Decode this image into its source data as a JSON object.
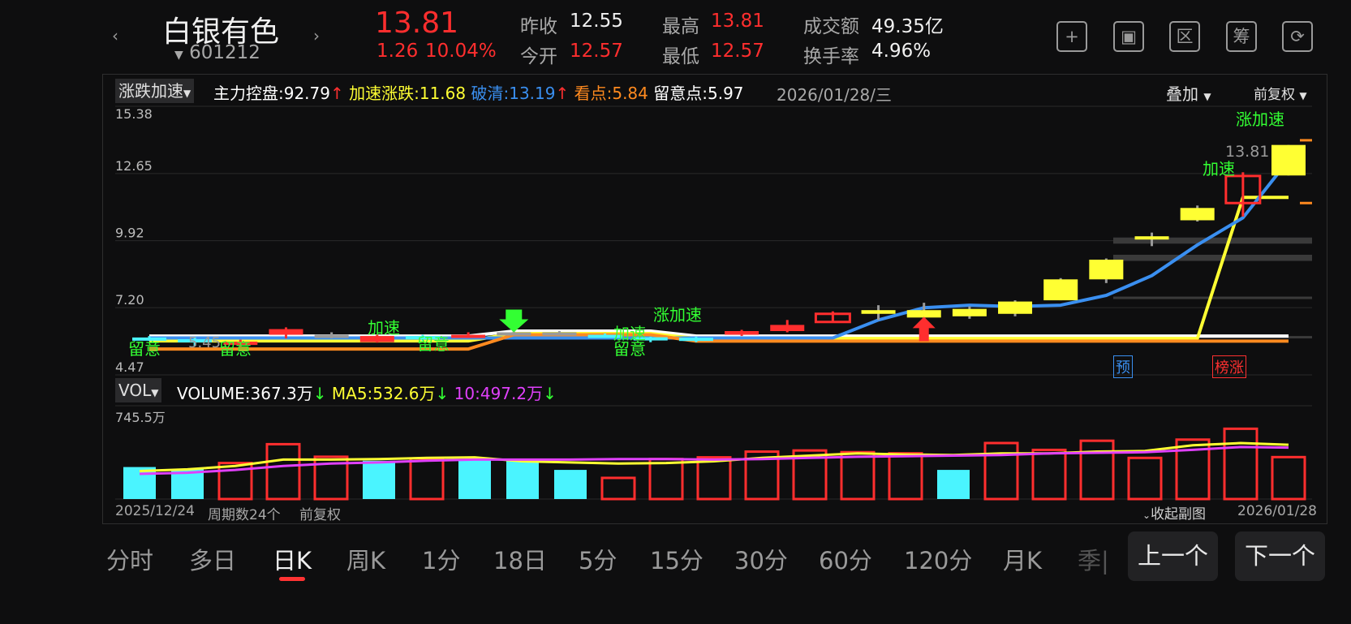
{
  "header": {
    "stock_name": "白银有色",
    "stock_code": "601212",
    "price": "13.81",
    "change": "1.26",
    "change_pct": "10.04%",
    "stats": {
      "prev_close_label": "昨收",
      "prev_close": "12.55",
      "open_label": "今开",
      "open": "12.57",
      "high_label": "最高",
      "high": "13.81",
      "low_label": "最低",
      "low": "12.57",
      "amount_label": "成交额",
      "amount": "49.35亿",
      "turnover_label": "换手率",
      "turnover": "4.96%"
    },
    "icons": [
      "add-icon",
      "screen-icon",
      "range-icon",
      "chips-icon",
      "rotate-icon"
    ],
    "icon_glyphs": {
      "add": "+",
      "screen": "▣",
      "range": "区",
      "chips": "筹",
      "rotate": "⟳"
    }
  },
  "main_chart": {
    "indicator_name": "涨跌加速",
    "indicators": [
      {
        "label": "主力控盘:92.79",
        "color": "#ffffff",
        "arrow": "↑"
      },
      {
        "label": "加速涨跌:11.68",
        "color": "#ffff33",
        "arrow": ""
      },
      {
        "label": "破清:13.19",
        "color": "#3a8ff0",
        "arrow": "↑"
      },
      {
        "label": "看点:5.84",
        "color": "#ff8a1f",
        "arrow": ""
      },
      {
        "label": "留意点:5.97",
        "color": "#ffffff",
        "arrow": ""
      }
    ],
    "date": "2026/01/28/三",
    "overlay_label": "叠加",
    "adjust_label": "前复权",
    "y_ticks": [
      "15.38",
      "12.65",
      "9.92",
      "7.20",
      "4.47"
    ],
    "price_label": "13.81",
    "annotations": {
      "zhangjiasu_top": "涨加速",
      "jiasu_right": "加速",
      "zhangjiasu_mid": "涨加速",
      "jiasu_1": "加速",
      "jiasu_2": "加速",
      "liuyi_1": "留意",
      "liuyi_2": "留意",
      "liuyi_3": "留意",
      "liuyi_4": "留意",
      "value_545": "5.45",
      "yu_badge": "预",
      "bangzhang_badge": "榜涨"
    }
  },
  "volume_chart": {
    "indicator_name": "VOL",
    "volume_label": "VOLUME:367.3万",
    "ma5_label": "MA5:532.6万",
    "ma10_label": "10:497.2万",
    "max_label": "745.5万",
    "start_date": "2025/12/24",
    "period_count": "周期数24个",
    "adjust": "前复权",
    "collapse_label": "收起副图",
    "end_date": "2026/01/28"
  },
  "chart_data": {
    "type": "candlestick",
    "ylim": [
      4.47,
      15.38
    ],
    "candles": [
      {
        "o": 5.99,
        "c": 5.97,
        "h": 6.05,
        "l": 5.85,
        "color": "cyan"
      },
      {
        "o": 5.92,
        "c": 5.88,
        "h": 6.0,
        "l": 5.65,
        "color": "cyan"
      },
      {
        "o": 5.7,
        "c": 5.82,
        "h": 5.9,
        "l": 5.6,
        "color": "red"
      },
      {
        "o": 6.1,
        "c": 6.33,
        "h": 6.4,
        "l": 5.95,
        "color": "red"
      },
      {
        "o": 6.02,
        "c": 6.1,
        "h": 6.2,
        "l": 5.95,
        "color": "gray"
      },
      {
        "o": 5.8,
        "c": 6.05,
        "h": 6.1,
        "l": 5.78,
        "color": "red"
      },
      {
        "o": 6.05,
        "c": 5.92,
        "h": 6.1,
        "l": 5.85,
        "color": "cyan"
      },
      {
        "o": 6.05,
        "c": 6.1,
        "h": 6.2,
        "l": 5.98,
        "color": "red"
      },
      {
        "o": 6.18,
        "c": 6.2,
        "h": 6.25,
        "l": 6.1,
        "color": "gray"
      },
      {
        "o": 6.2,
        "c": 6.15,
        "h": 6.25,
        "l": 6.08,
        "color": "gray"
      },
      {
        "o": 6.1,
        "c": 6.05,
        "h": 6.15,
        "l": 6.0,
        "color": "cyan"
      },
      {
        "o": 6.0,
        "c": 5.9,
        "h": 6.02,
        "l": 5.8,
        "color": "cyan"
      },
      {
        "o": 5.98,
        "c": 5.88,
        "h": 6.02,
        "l": 5.8,
        "color": "cyan"
      },
      {
        "o": 6.1,
        "c": 6.25,
        "h": 6.3,
        "l": 6.05,
        "color": "red"
      },
      {
        "o": 6.25,
        "c": 6.5,
        "h": 6.7,
        "l": 6.2,
        "color": "red"
      },
      {
        "o": 6.62,
        "c": 6.95,
        "h": 7.05,
        "l": 6.6,
        "color": "red"
      },
      {
        "o": 6.95,
        "c": 7.1,
        "h": 7.3,
        "l": 6.7,
        "color": "yellow"
      },
      {
        "o": 7.1,
        "c": 6.8,
        "h": 7.4,
        "l": 6.7,
        "color": "yellow"
      },
      {
        "o": 6.85,
        "c": 7.15,
        "h": 7.25,
        "l": 6.75,
        "color": "yellow"
      },
      {
        "o": 6.95,
        "c": 7.45,
        "h": 7.5,
        "l": 6.85,
        "color": "yellow"
      },
      {
        "o": 7.5,
        "c": 8.35,
        "h": 8.4,
        "l": 7.5,
        "color": "yellow"
      },
      {
        "o": 8.35,
        "c": 9.15,
        "h": 9.2,
        "l": 8.2,
        "color": "yellow"
      },
      {
        "o": 10.05,
        "c": 10.1,
        "h": 10.25,
        "l": 9.7,
        "color": "yellow"
      },
      {
        "o": 10.75,
        "c": 11.25,
        "h": 11.35,
        "l": 10.7,
        "color": "yellow"
      },
      {
        "o": 11.45,
        "c": 12.55,
        "h": 12.7,
        "l": 10.9,
        "color": "red"
      },
      {
        "o": 12.57,
        "c": 13.81,
        "h": 13.81,
        "l": 12.57,
        "color": "yellow"
      }
    ],
    "series": [
      {
        "name": "主力控盘",
        "color": "#ffffff",
        "values": [
          6.05,
          6.05,
          6.05,
          6.05,
          6.05,
          6.05,
          6.05,
          6.05,
          6.25,
          6.25,
          6.25,
          6.25,
          6.05,
          6.05,
          6.05,
          6.05,
          6.05,
          6.05,
          6.05,
          6.05,
          6.05,
          6.05,
          6.05,
          6.05,
          6.05,
          6.05
        ]
      },
      {
        "name": "加速涨跌",
        "color": "#ffff33",
        "values": [
          5.85,
          5.85,
          5.85,
          5.85,
          5.85,
          5.85,
          5.85,
          5.85,
          6.15,
          6.15,
          6.15,
          6.15,
          5.95,
          5.95,
          5.95,
          5.95,
          5.95,
          5.95,
          5.95,
          5.95,
          5.95,
          5.95,
          5.95,
          5.95,
          11.68,
          11.68
        ]
      },
      {
        "name": "破清",
        "color": "#3a8ff0",
        "values": [
          5.97,
          5.97,
          5.97,
          5.97,
          5.97,
          5.97,
          5.97,
          5.97,
          5.97,
          5.97,
          5.97,
          5.97,
          5.97,
          5.97,
          5.97,
          5.97,
          6.7,
          7.2,
          7.3,
          7.25,
          7.3,
          7.7,
          8.5,
          9.75,
          10.85,
          13.19
        ]
      },
      {
        "name": "看点",
        "color": "#ff8a1f",
        "values": [
          5.52,
          5.52,
          5.52,
          5.52,
          5.52,
          5.52,
          5.52,
          5.52,
          6.1,
          6.1,
          6.1,
          6.1,
          5.84,
          5.84,
          5.84,
          5.84,
          5.84,
          5.84,
          5.84,
          5.84,
          5.84,
          5.84,
          5.84,
          5.84,
          5.84,
          5.84
        ]
      }
    ],
    "volume": {
      "ylim": [
        0,
        745.5
      ],
      "values": [
        280,
        260,
        315,
        480,
        370,
        335,
        355,
        350,
        355,
        255,
        185,
        350,
        365,
        415,
        425,
        410,
        400,
        255,
        490,
        430,
        510,
        360,
        520,
        615,
        367
      ],
      "up": [
        false,
        false,
        true,
        true,
        true,
        false,
        true,
        false,
        false,
        false,
        true,
        true,
        true,
        true,
        true,
        true,
        true,
        false,
        true,
        true,
        true,
        true,
        true,
        true,
        true
      ],
      "ma5": [
        245,
        260,
        290,
        345,
        345,
        350,
        360,
        365,
        330,
        320,
        310,
        315,
        330,
        360,
        380,
        400,
        390,
        385,
        400,
        400,
        415,
        420,
        470,
        490,
        475
      ],
      "ma10": [
        220,
        230,
        255,
        290,
        310,
        320,
        335,
        345,
        345,
        345,
        350,
        350,
        345,
        350,
        360,
        370,
        375,
        380,
        385,
        400,
        405,
        410,
        430,
        455,
        450
      ]
    }
  }
}
